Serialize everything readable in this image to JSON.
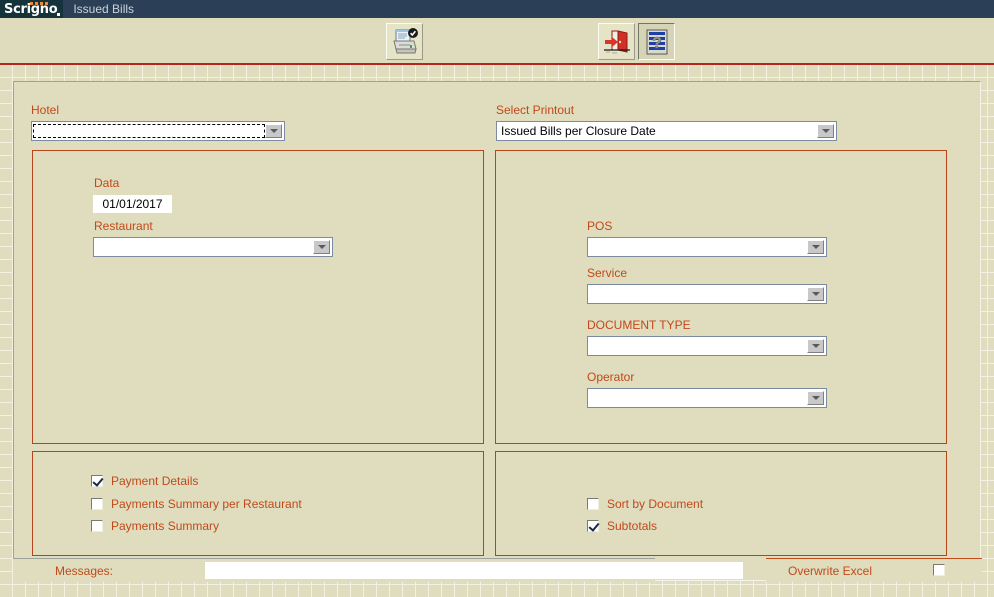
{
  "window": {
    "logo": "Scrigno",
    "title": "Issued Bills"
  },
  "toolbar": {
    "buttons": [
      {
        "name": "print-preview",
        "label": "Print",
        "icon": "printer-check-icon",
        "state": "raised"
      },
      {
        "name": "exit",
        "label": "Exit",
        "icon": "exit-door-icon",
        "state": "raised"
      },
      {
        "name": "help",
        "label": "Help",
        "icon": "help-document-icon",
        "state": "pressed"
      }
    ]
  },
  "form": {
    "hotel": {
      "label": "Hotel",
      "value": "",
      "focused": true
    },
    "select_printout": {
      "label": "Select Printout",
      "value": "Issued Bills per Closure Date"
    },
    "left_panel": {
      "date": {
        "label": "Data",
        "value": "01/01/2017"
      },
      "restaurant": {
        "label": "Restaurant",
        "value": ""
      }
    },
    "right_panel": {
      "pos": {
        "label": "POS",
        "value": ""
      },
      "service": {
        "label": "Service",
        "value": ""
      },
      "document_type": {
        "label": "DOCUMENT TYPE",
        "value": ""
      },
      "operator": {
        "label": "Operator",
        "value": ""
      }
    },
    "left_options": [
      {
        "label": "Payment Details",
        "checked": true
      },
      {
        "label": "Payments Summary per Restaurant",
        "checked": false
      },
      {
        "label": "Payments Summary",
        "checked": false
      }
    ],
    "right_options": [
      {
        "label": "Sort by Document",
        "checked": false
      },
      {
        "label": "Subtotals",
        "checked": true
      }
    ]
  },
  "status": {
    "messages_label": "Messages:",
    "messages_value": "",
    "overwrite_excel_label": "Overwrite Excel",
    "overwrite_excel_checked": false
  },
  "colors": {
    "background": "#dfddbe",
    "titlebar": "#2b3f56",
    "logo_bg": "#14333b",
    "accent_label": "#c2491a",
    "panel_border": "#b7441b",
    "divider_red": "#b5261d",
    "logo_dot": "#ef8a35"
  }
}
